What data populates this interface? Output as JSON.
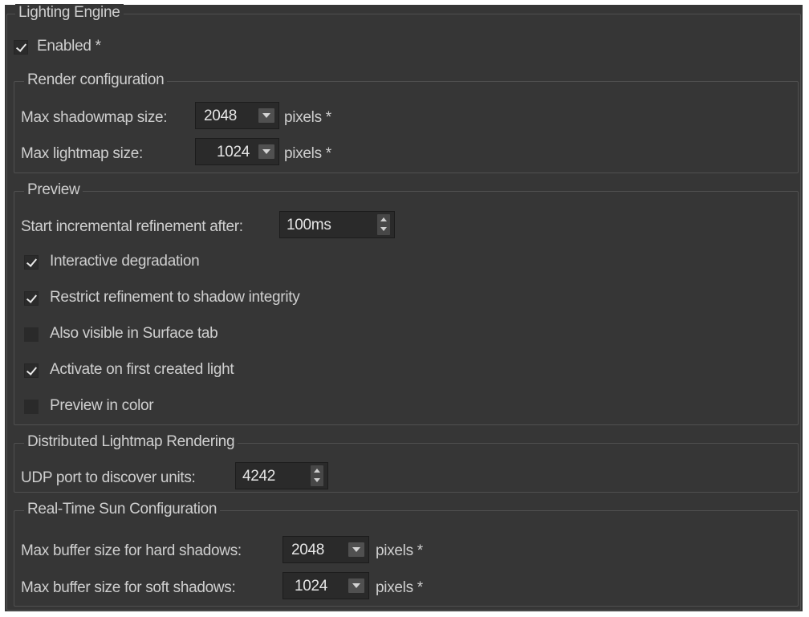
{
  "lighting_engine": {
    "title": "Lighting Engine",
    "enabled_label": "Enabled *",
    "enabled": true
  },
  "render_config": {
    "title": "Render configuration",
    "shadowmap_label": "Max shadowmap size:",
    "shadowmap_value": "2048",
    "shadowmap_unit": "pixels *",
    "lightmap_label": "Max lightmap size:",
    "lightmap_value": "1024",
    "lightmap_unit": "pixels *"
  },
  "preview": {
    "title": "Preview",
    "refine_label": "Start incremental refinement after:",
    "refine_value": "100ms",
    "checkboxes": [
      {
        "label": "Interactive degradation",
        "checked": true
      },
      {
        "label": "Restrict refinement to shadow integrity",
        "checked": true
      },
      {
        "label": "Also visible in Surface tab",
        "checked": false
      },
      {
        "label": "Activate on first created light",
        "checked": true
      },
      {
        "label": "Preview in color",
        "checked": false
      }
    ]
  },
  "distributed": {
    "title": "Distributed Lightmap Rendering",
    "udp_label": "UDP port to discover units:",
    "udp_value": "4242"
  },
  "sun": {
    "title": "Real-Time Sun Configuration",
    "hard_label": "Max buffer size for hard shadows:",
    "hard_value": "2048",
    "hard_unit": "pixels *",
    "soft_label": "Max buffer size for soft shadows:",
    "soft_value": "1024",
    "soft_unit": "pixels *"
  },
  "colors": {
    "panel_bg": "#363636",
    "field_bg": "#2a2a2a",
    "text": "#cfcfcf",
    "group_border": "#505050"
  }
}
